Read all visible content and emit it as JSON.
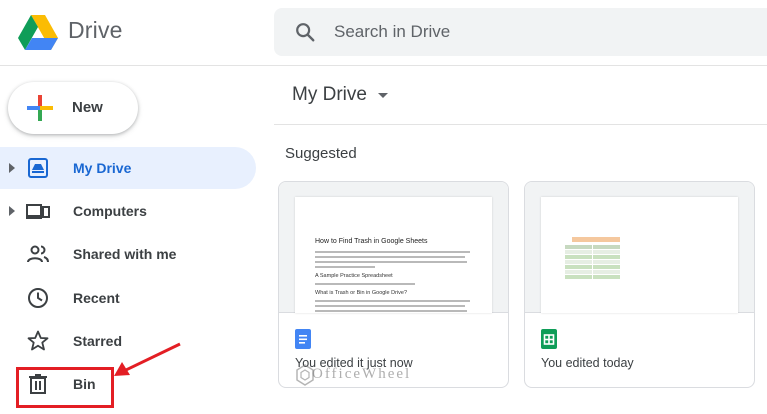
{
  "header": {
    "app_name": "Drive",
    "search_placeholder": "Search in Drive"
  },
  "sidebar": {
    "new_label": "New",
    "items": [
      {
        "label": "My Drive",
        "icon": "my-drive-icon",
        "active": true,
        "expandable": true
      },
      {
        "label": "Computers",
        "icon": "computers-icon",
        "active": false,
        "expandable": true
      },
      {
        "label": "Shared with me",
        "icon": "shared-with-me-icon",
        "active": false,
        "expandable": false
      },
      {
        "label": "Recent",
        "icon": "clock-icon",
        "active": false,
        "expandable": false
      },
      {
        "label": "Starred",
        "icon": "star-icon",
        "active": false,
        "expandable": false
      },
      {
        "label": "Bin",
        "icon": "bin-icon",
        "active": false,
        "expandable": false
      }
    ]
  },
  "main": {
    "title": "My Drive",
    "section_label": "Suggested",
    "cards": [
      {
        "type": "doc",
        "icon": "google-docs-icon",
        "caption": "You edited it just now",
        "preview": {
          "heading": "How to Find Trash in Google Sheets",
          "subheading_1": "A Sample Practice Spreadsheet",
          "subheading_2": "What is Trash or Bin in Google Drive?"
        }
      },
      {
        "type": "sheet",
        "icon": "google-sheets-icon",
        "caption": "You edited today"
      }
    ]
  },
  "watermark": "OfficeWheel",
  "colors": {
    "accent": "#1967d2",
    "active_bg": "#e8f0fe",
    "annotation_red": "#e31e24",
    "docs_blue": "#4285f4",
    "sheets_green": "#0f9d58"
  }
}
